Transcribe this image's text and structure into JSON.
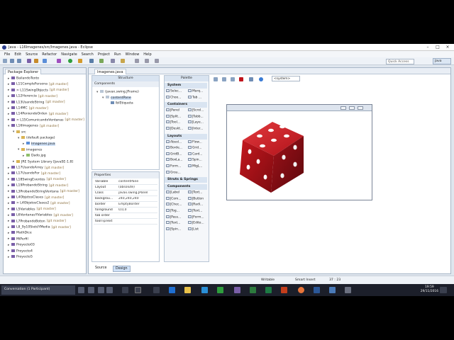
{
  "window": {
    "title": "Java - L16Imagenes/src/Imagenes.java - Eclipse"
  },
  "menu": [
    "File",
    "Edit",
    "Source",
    "Refactor",
    "Navigate",
    "Search",
    "Project",
    "Run",
    "Window",
    "Help"
  ],
  "quick_access": {
    "placeholder": "Quick Access"
  },
  "perspective": {
    "label": "Java"
  },
  "package_explorer": {
    "tab": "Package Explorer",
    "items": [
      {
        "text": "BailandoTexto",
        "git": "",
        "indent": 0,
        "icon": "project"
      },
      {
        "text": "L11CompleFersona",
        "git": "[git master]",
        "indent": 0,
        "icon": "project"
      },
      {
        "text": "> L11SwingObjects",
        "git": "[git master]",
        "indent": 0,
        "icon": "project"
      },
      {
        "text": "L12Herencia",
        "git": "[git master]",
        "indent": 0,
        "icon": "project"
      },
      {
        "text": "L13UsandoString",
        "git": "[git master]",
        "indent": 0,
        "icon": "project"
      },
      {
        "text": "L14MC",
        "git": "[git master]",
        "indent": 0,
        "icon": "project"
      },
      {
        "text": "L14PoniendoOrden",
        "git": "[git master]",
        "indent": 0,
        "icon": "project"
      },
      {
        "text": "> L15ComunicandoVentanas",
        "git": "[git master]",
        "indent": 0,
        "icon": "project"
      },
      {
        "text": "L16Imagenes",
        "git": "[git master]",
        "indent": 0,
        "icon": "project"
      },
      {
        "text": "src",
        "git": "",
        "indent": 1,
        "icon": "folder"
      },
      {
        "text": "(default package)",
        "git": "",
        "indent": 2,
        "icon": "folder"
      },
      {
        "text": "Imagenes.java",
        "git": "",
        "indent": 3,
        "icon": "java",
        "selected": true
      },
      {
        "text": "imagenes",
        "git": "",
        "indent": 2,
        "icon": "folder"
      },
      {
        "text": "Dado.jpg",
        "git": "",
        "indent": 3,
        "icon": "img"
      },
      {
        "text": "JRE System Library [JavaSE-1.8]",
        "git": "",
        "indent": 1,
        "icon": "folder"
      },
      {
        "text": "L17UsandoArrey",
        "git": "[git master]",
        "indent": 0,
        "icon": "project"
      },
      {
        "text": "L17UsandoFor",
        "git": "[git master]",
        "indent": 0,
        "icon": "project"
      },
      {
        "text": "L18SwingEventos",
        "git": "[git master]",
        "indent": 0,
        "icon": "project"
      },
      {
        "text": "L19ProbandoString",
        "git": "[git master]",
        "indent": 0,
        "icon": "project"
      },
      {
        "text": "L3ProbandoStringVentana",
        "git": "[git master]",
        "indent": 0,
        "icon": "project"
      },
      {
        "text": "L4ObjetosClases",
        "git": "[git master]",
        "indent": 0,
        "icon": "project"
      },
      {
        "text": "> L4ObjetosClases2",
        "git": "[git master]",
        "indent": 0,
        "icon": "project"
      },
      {
        "text": "L5Variables",
        "git": "[git master]",
        "indent": 0,
        "icon": "project"
      },
      {
        "text": "L6VentanasYVariables",
        "git": "[git master]",
        "indent": 0,
        "icon": "project"
      },
      {
        "text": "L7ProbandoBoton",
        "git": "[git master]",
        "indent": 0,
        "icon": "project"
      },
      {
        "text": "L8_9y10SietéYMedia",
        "git": "[git master]",
        "indent": 0,
        "icon": "project"
      },
      {
        "text": "MathDice",
        "git": "",
        "indent": 0,
        "icon": "project"
      },
      {
        "text": "MiPerfil",
        "git": "",
        "indent": 0,
        "icon": "project"
      },
      {
        "text": "Proyecto03",
        "git": "",
        "indent": 0,
        "icon": "project"
      },
      {
        "text": "Proyecto4",
        "git": "",
        "indent": 0,
        "icon": "project"
      },
      {
        "text": "Proyecto5",
        "git": "",
        "indent": 0,
        "icon": "project"
      }
    ]
  },
  "editor": {
    "tab": "Imagenes.java",
    "structure_title": "Structure",
    "components_label": "Components",
    "component_tree": [
      "(javax.swing.JFrame)",
      "contentPane",
      "lblEtiqueta"
    ],
    "properties_label": "Properties",
    "properties": [
      {
        "key": "Variable",
        "value": "contentPane"
      },
      {
        "key": "Layout",
        "value": "(absolute)"
      },
      {
        "key": "Class",
        "value": "javax.swing.JPanel"
      },
      {
        "key": "backgrou...",
        "value": "240,240,240"
      },
      {
        "key": "border",
        "value": "EmptyBorder"
      },
      {
        "key": "foreground",
        "value": "0,0,0"
      },
      {
        "key": "tab order",
        "value": ""
      },
      {
        "key": "toolTipText",
        "value": ""
      }
    ],
    "palette_title": "Palette",
    "palette": [
      {
        "category": "System",
        "items": [
          [
            "Selec...",
            "Marq..."
          ],
          [
            "Choo...",
            "Tab ..."
          ]
        ]
      },
      {
        "category": "Containers",
        "items": [
          [
            "JPanel",
            "JScrol..."
          ],
          [
            "JSplit...",
            "JTabb..."
          ],
          [
            "JTool...",
            "JLaye..."
          ],
          [
            "JDeskt...",
            "JInter..."
          ]
        ]
      },
      {
        "category": "Layouts",
        "items": [
          [
            "Absol...",
            "Flow..."
          ],
          [
            "Borde...",
            "Grid..."
          ],
          [
            "GridB...",
            "Card..."
          ],
          [
            "BoxLa...",
            "Spin..."
          ],
          [
            "Form...",
            "MigL..."
          ],
          [
            "Grou...",
            ""
          ]
        ]
      },
      {
        "category": "Struts & Springs",
        "items": []
      },
      {
        "category": "Components",
        "items": [
          [
            "JLabel",
            "JText..."
          ],
          [
            "JCom...",
            "JButton"
          ],
          [
            "JChec...",
            "JRadi..."
          ],
          [
            "JTog...",
            "JText..."
          ],
          [
            "JPass...",
            "JForm..."
          ],
          [
            "JText...",
            "JEdito..."
          ],
          [
            "JSpin...",
            "JList"
          ]
        ]
      }
    ],
    "system_dropdown": "<system>",
    "bottom_tabs": [
      "Source",
      "Design"
    ]
  },
  "status": {
    "writable": "Writable",
    "insert": "Smart Insert",
    "position": "37 : 23"
  },
  "taskbar": {
    "conversation": "Conversation (1 Participant)",
    "time": "19:59",
    "date": "29/11/2016"
  },
  "colors": {
    "die_red": "#c0141c",
    "die_dark": "#7d0b10",
    "git_tag": "#8a6d3b",
    "selection": "#cfe1f7"
  }
}
